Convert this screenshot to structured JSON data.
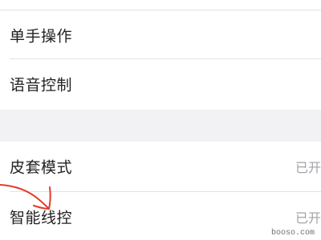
{
  "settings": {
    "items": [
      {
        "label": "单手操作",
        "value": ""
      },
      {
        "label": "语音控制",
        "value": ""
      },
      {
        "label": "皮套模式",
        "value": "已开"
      },
      {
        "label": "智能线控",
        "value": "已开"
      }
    ]
  },
  "watermark": "booso.com",
  "colors": {
    "background": "#f2f2f4",
    "row_bg": "#ffffff",
    "annotation_stroke": "#e53a2a"
  }
}
